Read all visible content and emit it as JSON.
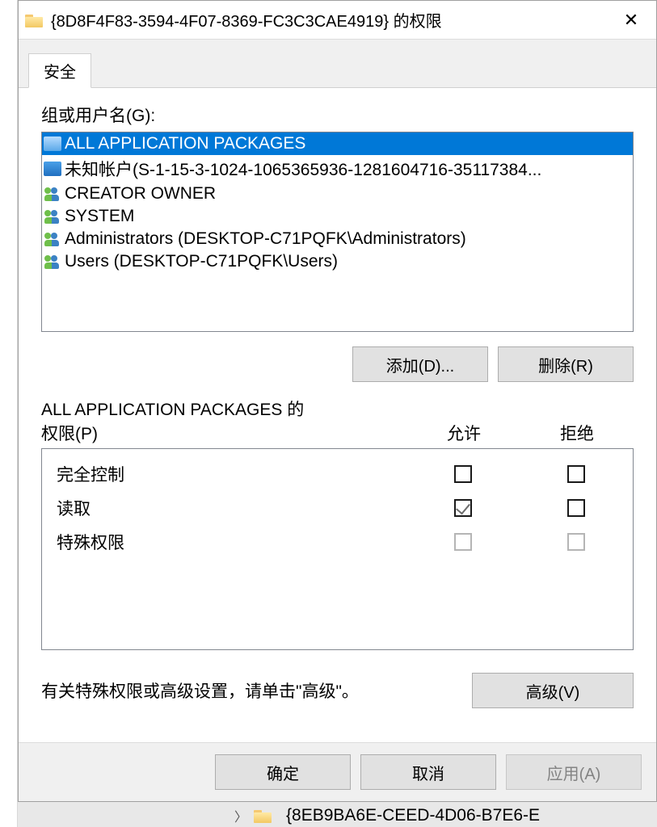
{
  "titlebar": {
    "title": "{8D8F4F83-3594-4F07-8369-FC3C3CAE4919} 的权限",
    "close_glyph": "✕"
  },
  "tabs": {
    "security": "安全"
  },
  "groups_label": "组或用户名(G):",
  "users": [
    {
      "name": "ALL APPLICATION PACKAGES",
      "icon": "pkg",
      "selected": true
    },
    {
      "name": "未知帐户(S-1-15-3-1024-1065365936-1281604716-35117384...",
      "icon": "pkg",
      "selected": false
    },
    {
      "name": "CREATOR OWNER",
      "icon": "users",
      "selected": false
    },
    {
      "name": "SYSTEM",
      "icon": "users",
      "selected": false
    },
    {
      "name": "Administrators (DESKTOP-C71PQFK\\Administrators)",
      "icon": "users",
      "selected": false
    },
    {
      "name": "Users (DESKTOP-C71PQFK\\Users)",
      "icon": "users",
      "selected": false
    }
  ],
  "buttons": {
    "add": "添加(D)...",
    "remove": "删除(R)",
    "advanced": "高级(V)",
    "ok": "确定",
    "cancel": "取消",
    "apply": "应用(A)"
  },
  "perm_header": {
    "title_line1": "ALL APPLICATION PACKAGES 的",
    "title_line2": "权限(P)",
    "allow": "允许",
    "deny": "拒绝"
  },
  "permissions": [
    {
      "name": "完全控制",
      "allow": false,
      "deny": false,
      "dim": false
    },
    {
      "name": "读取",
      "allow": true,
      "deny": false,
      "dim": false
    },
    {
      "name": "特殊权限",
      "allow": false,
      "deny": false,
      "dim": true
    }
  ],
  "hint": "有关特殊权限或高级设置，请单击\"高级\"。",
  "background": {
    "bottom_item": "{8EB9BA6E-CEED-4D06-B7E6-E"
  }
}
